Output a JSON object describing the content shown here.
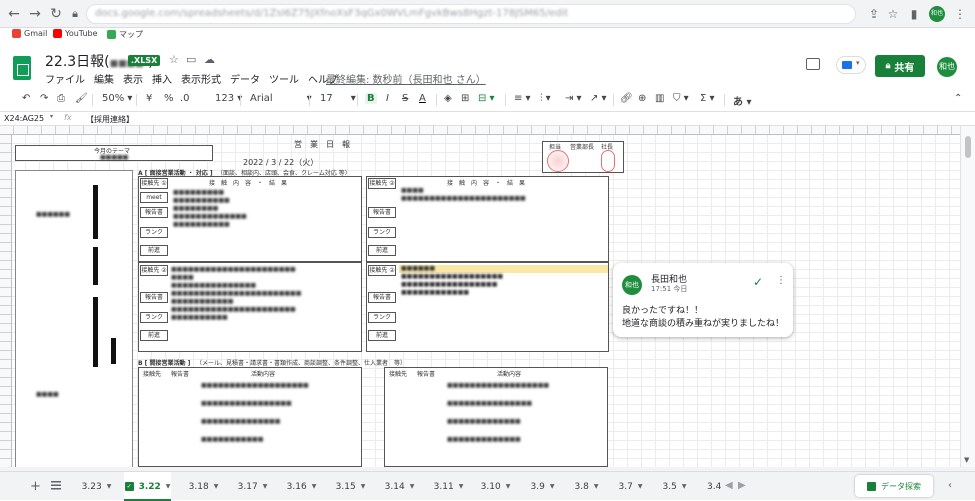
{
  "browser": {
    "url": "docs.google.com/spreadsheets/d/1ZsI6Z75JXfnoXsF3qGx0WVLmFgvkBws8Hgzt-178JSM65/edit",
    "profile": "和也",
    "bookmarks": [
      {
        "label": "Gmail",
        "color": "#ea4335"
      },
      {
        "label": "YouTube",
        "color": "#ff0000"
      },
      {
        "label": "マップ",
        "color": "#34a853"
      }
    ]
  },
  "doc": {
    "title": "22.3日報(",
    "title_rest": "      )",
    "badge": ".XLSX",
    "last_edit": "最終編集: 数秒前（長田和也 さん）",
    "share_label": "共有",
    "avatar": "和也",
    "menu": [
      "ファイル",
      "編集",
      "表示",
      "挿入",
      "表示形式",
      "データ",
      "ツール",
      "ヘルプ"
    ]
  },
  "toolbar": {
    "zoom": "50%",
    "currency": "¥",
    "percent": "%",
    "dec_less": ".0",
    ".dec_more": ".00",
    "format123": "123",
    "font": "Arial",
    "size": "17",
    "bold": "B",
    "italic": "I",
    "strike": "S",
    "text_color": "A",
    "more": "あ"
  },
  "formula": {
    "namebox": "X24:AG25",
    "fx": "fx",
    "value": "【採用連絡】"
  },
  "sheet": {
    "report_title": "営　業　日　報",
    "date": "2022 / 3 / 22（火）",
    "section_a": "A [ 面接営業活動 ・ 対応 ]",
    "section_a_note": "（面談、相談内、店頭、会食、クレーム対応 等）",
    "col_content": "接　触　内　容　・　結　果",
    "contact_label": "接触先 ①",
    "contact_label2": "接触先 ②",
    "meet_label": "meet",
    "report_label": "報告書",
    "rank_label": "ランク",
    "next_label": "前進",
    "section_b": "B [ 間接営業活動 ]",
    "section_b_note": "（メール、見積書・請求書・書類作成、商談調整、条件調整、仕入業者　等）",
    "b_col1": "接触先",
    "b_col2": "報告書",
    "b_col3": "活動内容",
    "top_label": "今月のテーマ",
    "stamp_labels": [
      "担当",
      "営業部長",
      "社長"
    ]
  },
  "comment": {
    "avatar": "和也",
    "author": "長田和也",
    "time": "17:51 今日",
    "line1": "良かったですね！！",
    "line2": "地道な商談の積み重ねが実りましたね！"
  },
  "tabs": [
    {
      "label": "3.23",
      "active": false
    },
    {
      "label": "3.22",
      "active": true
    },
    {
      "label": "3.18",
      "active": false
    },
    {
      "label": "3.17",
      "active": false
    },
    {
      "label": "3.16",
      "active": false
    },
    {
      "label": "3.15",
      "active": false
    },
    {
      "label": "3.14",
      "active": false
    },
    {
      "label": "3.11",
      "active": false
    },
    {
      "label": "3.10",
      "active": false
    },
    {
      "label": "3.9",
      "active": false
    },
    {
      "label": "3.8",
      "active": false
    },
    {
      "label": "3.7",
      "active": false
    },
    {
      "label": "3.5",
      "active": false
    },
    {
      "label": "3.4",
      "active": false
    }
  ],
  "explore_label": "データ探索",
  "colors": {
    "accent": "#188038",
    "link_blue": "#3c4cd6",
    "highlight_row": "#f9e7a6"
  }
}
